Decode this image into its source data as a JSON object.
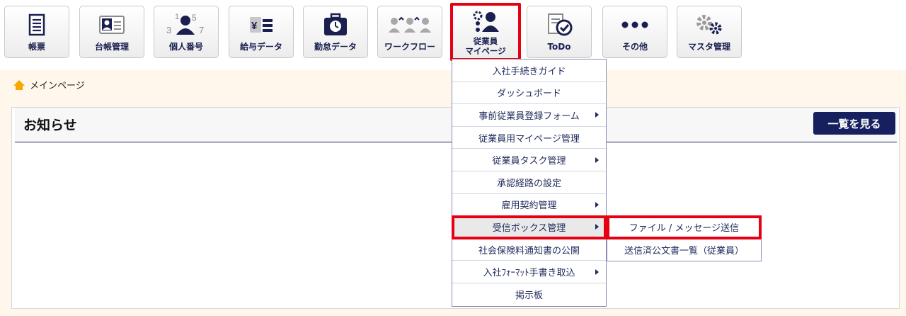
{
  "toolbar": {
    "items": [
      {
        "label": "帳票",
        "icon": "document-list-icon"
      },
      {
        "label": "台帳管理",
        "icon": "id-card-icon"
      },
      {
        "label": "個人番号",
        "icon": "person-number-icon"
      },
      {
        "label": "給与データ",
        "icon": "yen-salary-icon"
      },
      {
        "label": "勤怠データ",
        "icon": "clock-bag-icon"
      },
      {
        "label": "ワークフロー",
        "icon": "people-flow-icon"
      },
      {
        "label_line1": "従業員",
        "label_line2": "マイページ",
        "icon": "employee-gear-icon"
      },
      {
        "label": "ToDo",
        "icon": "todo-check-icon"
      },
      {
        "label": "その他",
        "icon": "more-dots-icon"
      },
      {
        "label": "マスタ管理",
        "icon": "gears-icon"
      }
    ]
  },
  "breadcrumb": {
    "label": "メインページ",
    "icon": "home-icon"
  },
  "notice": {
    "title": "お知らせ",
    "view_all": "一覧を見る"
  },
  "menu": {
    "items": [
      {
        "label": "入社手続きガイド"
      },
      {
        "label": "ダッシュボード"
      },
      {
        "label": "事前従業員登録フォーム"
      },
      {
        "label": "従業員用マイページ管理"
      },
      {
        "label": "従業員タスク管理"
      },
      {
        "label": "承認経路の設定"
      },
      {
        "label": "雇用契約管理"
      },
      {
        "label": "受信ボックス管理"
      },
      {
        "label": "社会保険料通知書の公開"
      },
      {
        "label": "入社ﾌｫｰﾏｯﾄ手書き取込"
      },
      {
        "label": "掲示板"
      }
    ],
    "submenu": [
      {
        "label": "ファイル / メッセージ送信"
      },
      {
        "label": "送信済公文書一覧（従業員）"
      }
    ]
  },
  "colors": {
    "highlight": "#e60012",
    "navy": "#16205e",
    "band": "#fff7ec"
  }
}
